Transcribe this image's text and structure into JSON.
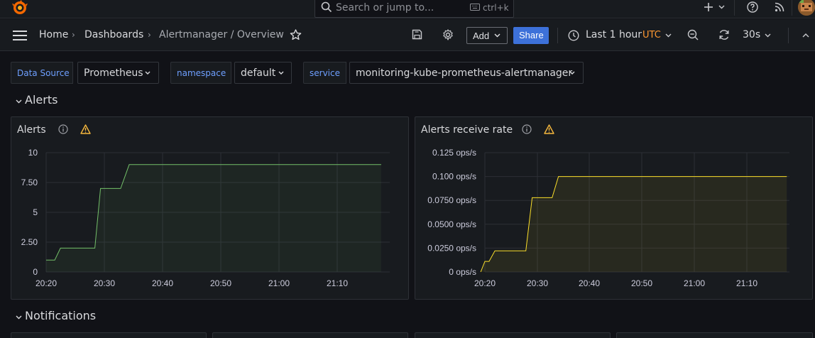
{
  "search": {
    "placeholder": "Search or jump to...",
    "shortcut": "ctrl+k"
  },
  "breadcrumb": {
    "home": "Home",
    "dashboards": "Dashboards",
    "current": "Alertmanager / Overview"
  },
  "toolbar": {
    "add_label": "Add",
    "share_label": "Share",
    "time_range": "Last 1 hour",
    "timezone": "UTC",
    "refresh_interval": "30s"
  },
  "variables": [
    {
      "label": "Data Source",
      "value": "Prometheus"
    },
    {
      "label": "namespace",
      "value": "default"
    },
    {
      "label": "service",
      "value": "monitoring-kube-prometheus-alertmanager"
    }
  ],
  "rows": {
    "alerts": "Alerts",
    "notifications": "Notifications"
  },
  "colors": {
    "accent": "#3d71d9",
    "warning": "#f5b73d",
    "series_green": "#73bf69",
    "series_yellow": "#fade2a",
    "utc": "#ff9830"
  },
  "chart_data": [
    {
      "type": "line",
      "title": "Alerts",
      "x_ticks": [
        "20:20",
        "20:30",
        "20:40",
        "20:50",
        "21:00",
        "21:10"
      ],
      "y_ticks": [
        "0",
        "2.50",
        "5",
        "7.50",
        "10"
      ],
      "ylim": [
        0,
        10
      ],
      "xlim_minutes": [
        0,
        60
      ],
      "series": [
        {
          "color": "#73bf69",
          "points": [
            [
              0,
              1
            ],
            [
              1.5,
              1
            ],
            [
              2.5,
              2
            ],
            [
              8.5,
              2
            ],
            [
              9.5,
              7
            ],
            [
              13,
              7
            ],
            [
              14.5,
              9
            ],
            [
              58.5,
              9
            ]
          ]
        }
      ]
    },
    {
      "type": "line",
      "title": "Alerts receive rate",
      "x_ticks": [
        "20:20",
        "20:30",
        "20:40",
        "20:50",
        "21:00",
        "21:10"
      ],
      "y_ticks": [
        "0 ops/s",
        "0.0250 ops/s",
        "0.0500 ops/s",
        "0.0750 ops/s",
        "0.100 ops/s",
        "0.125 ops/s"
      ],
      "ylim": [
        0,
        0.125
      ],
      "xlim_minutes": [
        0,
        58
      ],
      "series": [
        {
          "color": "#fade2a",
          "points": [
            [
              -0.8,
              0
            ],
            [
              0,
              0.0111
            ],
            [
              0.8,
              0.0111
            ],
            [
              1.9,
              0.0222
            ],
            [
              7.8,
              0.0222
            ],
            [
              9,
              0.0778
            ],
            [
              12.8,
              0.0778
            ],
            [
              14,
              0.1
            ],
            [
              57.5,
              0.1
            ]
          ]
        }
      ]
    }
  ]
}
